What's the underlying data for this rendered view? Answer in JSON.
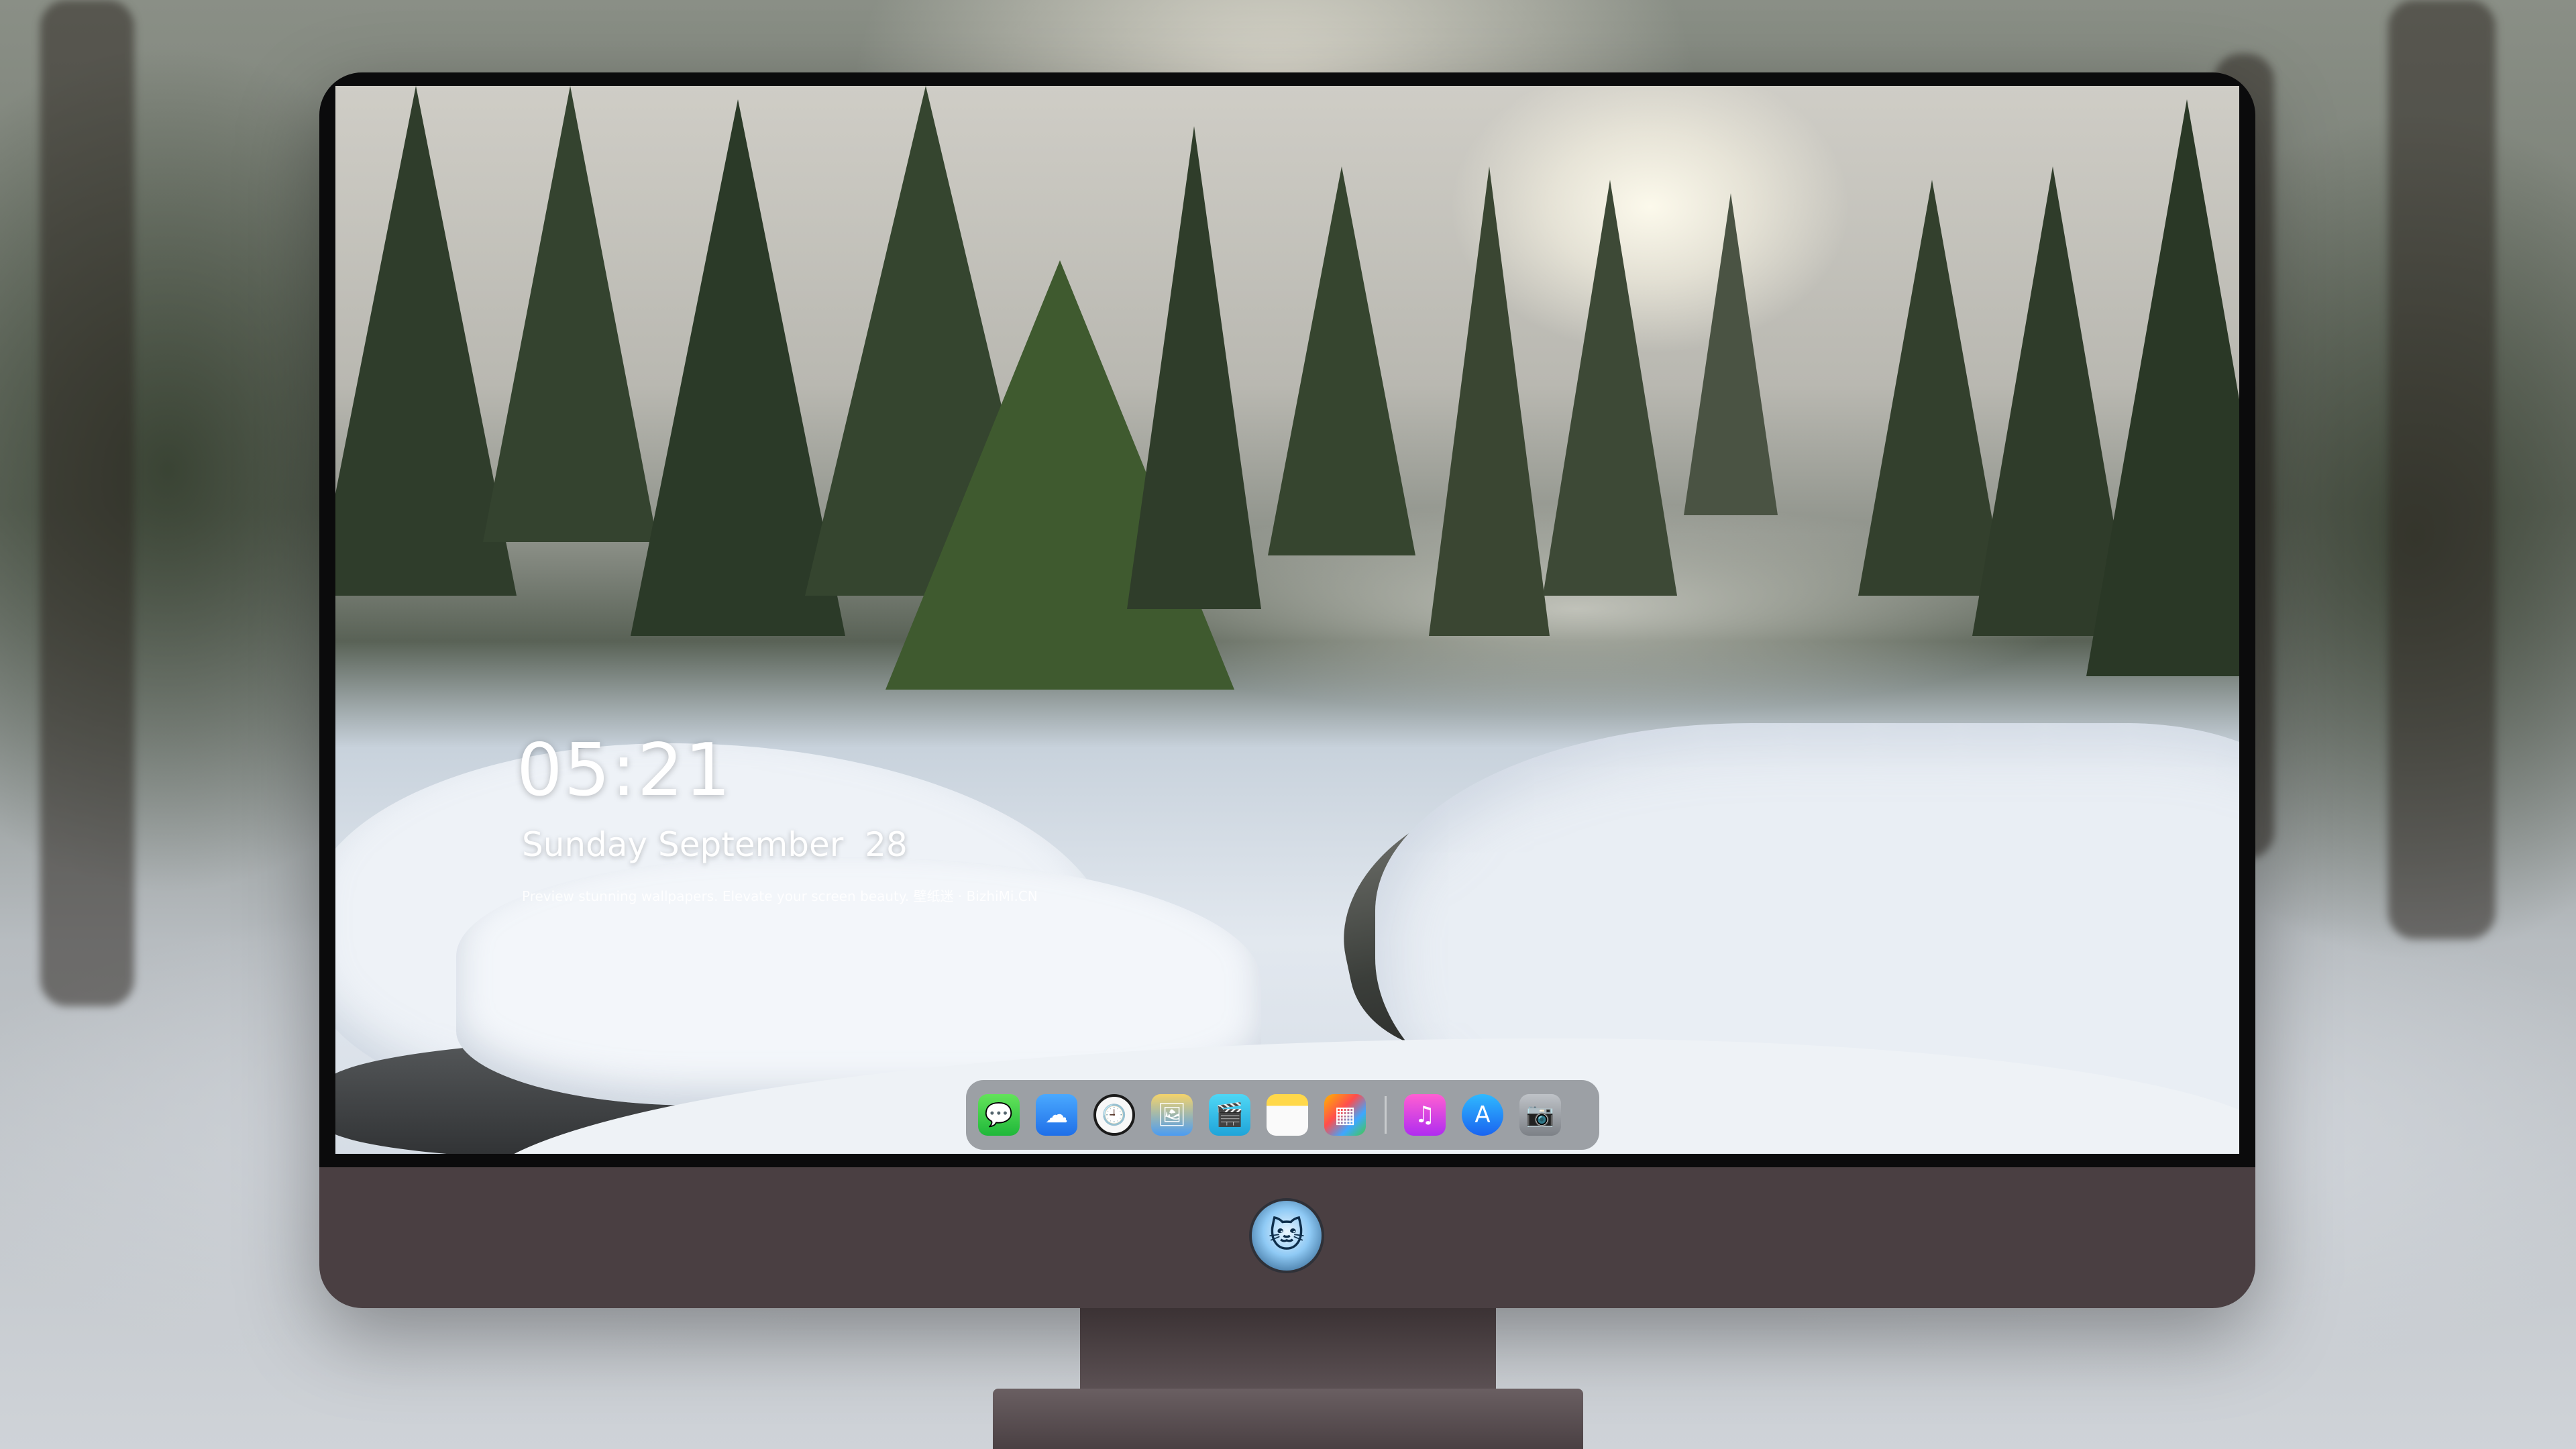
{
  "lockscreen": {
    "time": "05:21",
    "date": "Sunday September  28",
    "tagline": "Preview stunning wallpapers. Elevate your screen beauty. 壁纸迷 · BizhiMi.CN"
  },
  "dock": {
    "apps": [
      {
        "name": "messages",
        "glyph": "💬"
      },
      {
        "name": "weather",
        "glyph": "☁"
      },
      {
        "name": "clock",
        "glyph": "🕘"
      },
      {
        "name": "preview",
        "glyph": "🖼"
      },
      {
        "name": "clips",
        "glyph": "🎬"
      },
      {
        "name": "notes",
        "glyph": ""
      },
      {
        "name": "photos",
        "glyph": "▦"
      },
      {
        "name": "music",
        "glyph": "♫"
      },
      {
        "name": "app-store",
        "glyph": "A"
      },
      {
        "name": "screenshot",
        "glyph": "📷"
      }
    ]
  },
  "colors": {
    "monitor_body": "#4a3f42",
    "bezel": "#0b0b0c",
    "dock_bg": "rgba(90,92,98,0.55)",
    "text": "#ffffff"
  }
}
